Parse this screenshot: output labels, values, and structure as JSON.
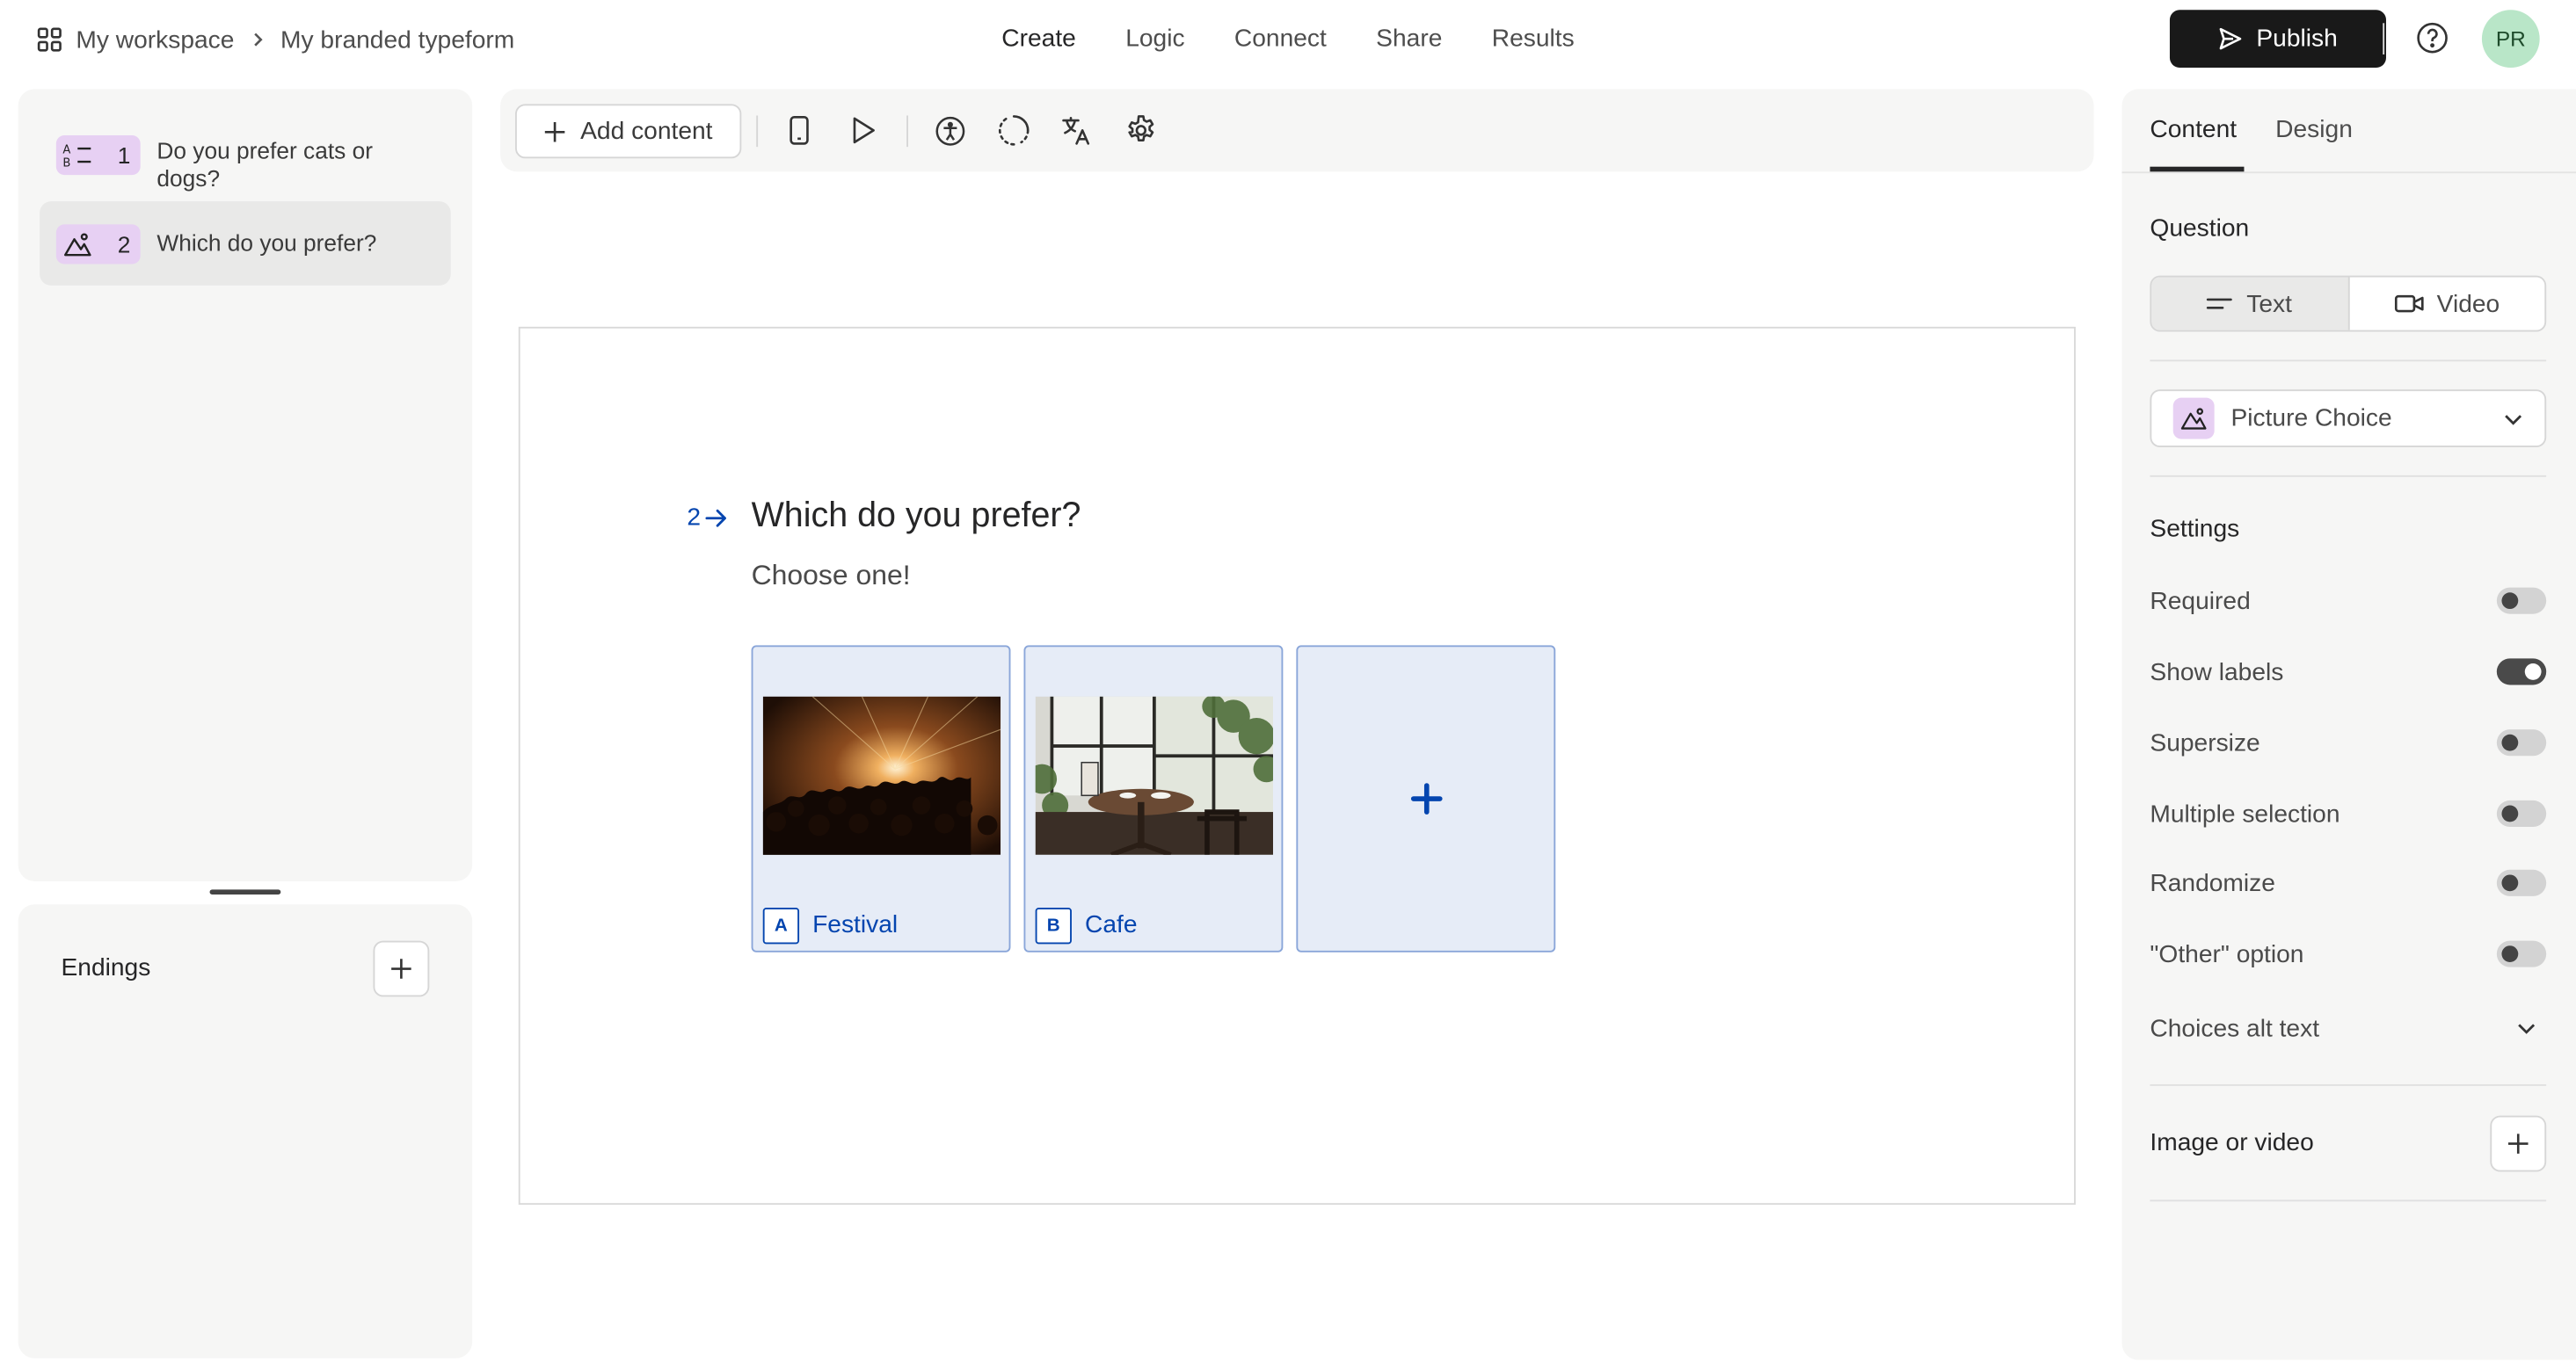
{
  "header": {
    "workspace": "My workspace",
    "form_name": "My branded typeform",
    "nav": [
      "Create",
      "Logic",
      "Connect",
      "Share",
      "Results"
    ],
    "active_nav": "Create",
    "publish_label": "Publish",
    "avatar_initials": "PR"
  },
  "sidebar": {
    "questions": [
      {
        "number": "1",
        "label": "Do you prefer cats or dogs?",
        "icon": "multiple-choice-icon"
      },
      {
        "number": "2",
        "label": "Which do you prefer?",
        "icon": "picture-choice-icon"
      }
    ],
    "endings_label": "Endings"
  },
  "toolbar": {
    "add_content_label": "Add content"
  },
  "canvas": {
    "question_number": "2",
    "title": "Which do you prefer?",
    "description": "Choose one!",
    "choices": [
      {
        "key": "A",
        "label": "Festival",
        "image": "concert-crowd-photo"
      },
      {
        "key": "B",
        "label": "Cafe",
        "image": "cafe-table-photo"
      }
    ]
  },
  "panel": {
    "tabs": [
      "Content",
      "Design"
    ],
    "active_tab": "Content",
    "question_label": "Question",
    "question_modes": [
      "Text",
      "Video"
    ],
    "question_type": "Picture Choice",
    "settings_label": "Settings",
    "settings": [
      {
        "label": "Required",
        "on": false
      },
      {
        "label": "Show labels",
        "on": true
      },
      {
        "label": "Supersize",
        "on": false
      },
      {
        "label": "Multiple selection",
        "on": false
      },
      {
        "label": "Randomize",
        "on": false
      },
      {
        "label": "\"Other\" option",
        "on": false
      }
    ],
    "alt_text_label": "Choices alt text",
    "media_label": "Image or video"
  },
  "colors": {
    "accent_blue": "#0445af",
    "choice_bg": "#e6ecf7",
    "badge_purple": "#e7d0f3",
    "avatar_green": "#b9e6c8"
  }
}
